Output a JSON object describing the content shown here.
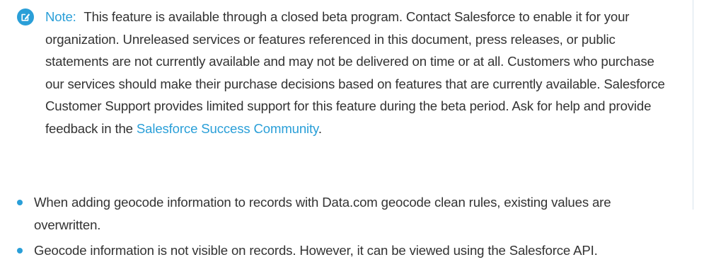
{
  "note": {
    "label": "Note:",
    "text": "This feature is available through a closed beta program. Contact Salesforce to enable it for your organization. Unreleased services or features referenced in this document, press releases, or public statements are not currently available and may not be delivered on time or at all. Customers who purchase our services should make their purchase decisions based on features that are currently available. Salesforce Customer Support provides limited support for this feature during the beta period. Ask for help and provide feedback in the",
    "link_text": "Salesforce Success Community",
    "end_punctuation": ".",
    "icon": "edit-note-icon",
    "accent_color": "#2a9fd8"
  },
  "bullets": [
    {
      "text": "When adding geocode information to records with Data.com geocode clean rules, existing values are overwritten."
    },
    {
      "text": "Geocode information is not visible on records. However, it can be viewed using the Salesforce API."
    }
  ],
  "bullet_color": "#2a9fd8"
}
